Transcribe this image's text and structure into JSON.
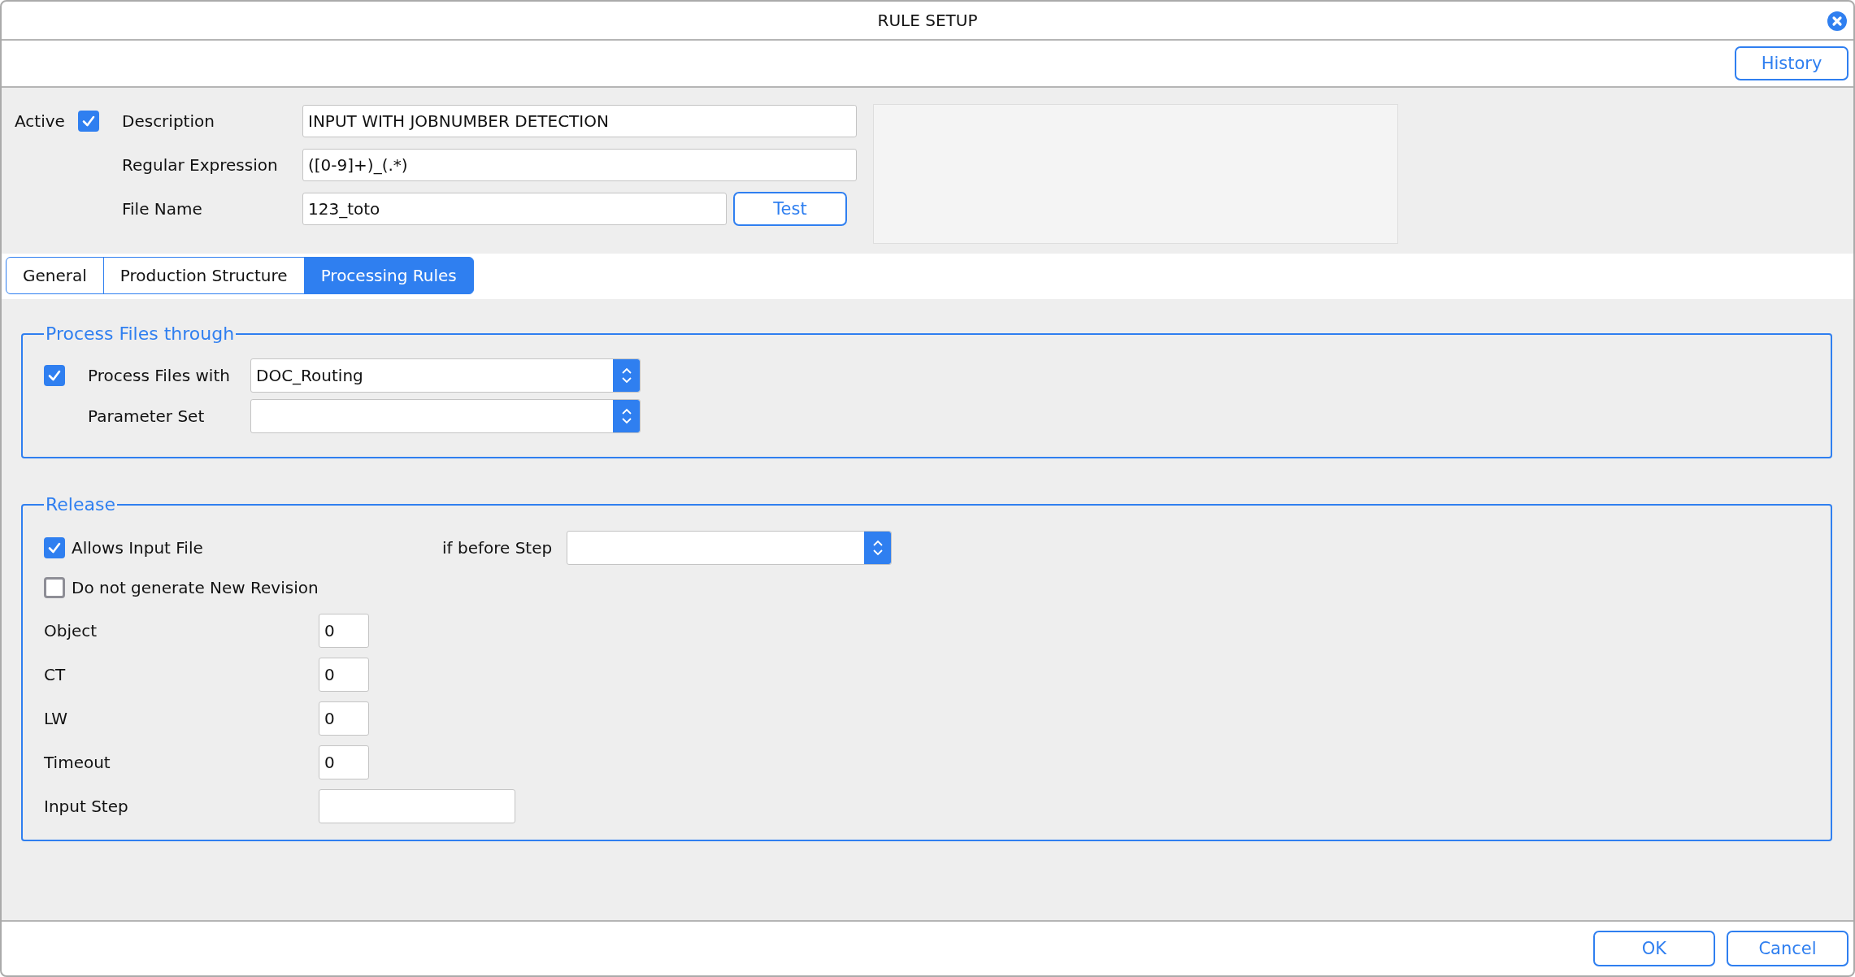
{
  "window": {
    "title": "RULE SETUP"
  },
  "toolbar": {
    "buttons": [
      "History"
    ]
  },
  "header": {
    "active": {
      "label": "Active",
      "checked": true
    },
    "fields": [
      {
        "label": "Description",
        "value": "INPUT WITH JOBNUMBER DETECTION"
      },
      {
        "label": "Regular Expression",
        "value": "([0-9]+)_(.*)"
      },
      {
        "label": "File Name",
        "value": "123_toto"
      }
    ],
    "test_button": "Test"
  },
  "tabs": [
    {
      "label": "General",
      "selected": false
    },
    {
      "label": "Production Structure",
      "selected": false
    },
    {
      "label": "Processing Rules",
      "selected": true
    }
  ],
  "process_files_through": {
    "title": "Process Files through",
    "process_with": {
      "label": "Process Files with",
      "checked": true,
      "value": "DOC_Routing"
    },
    "parameter_set": {
      "label": "Parameter Set"
    }
  },
  "release": {
    "title": "Release",
    "allows_input_file": {
      "label": "Allows Input File",
      "checked": true
    },
    "if_before_step": {
      "label": "if before Step"
    },
    "no_new_revision": {
      "label": "Do not generate New Revision",
      "checked": false
    },
    "fields": [
      {
        "label": "Object",
        "kind": "number",
        "value": "0"
      },
      {
        "label": "CT",
        "kind": "number",
        "value": "0"
      },
      {
        "label": "LW",
        "kind": "number",
        "value": "0"
      },
      {
        "label": "Timeout",
        "kind": "number",
        "value": "0"
      },
      {
        "label": "Input Step",
        "kind": "text"
      }
    ]
  },
  "footer": {
    "buttons": [
      "OK",
      "Cancel"
    ]
  }
}
